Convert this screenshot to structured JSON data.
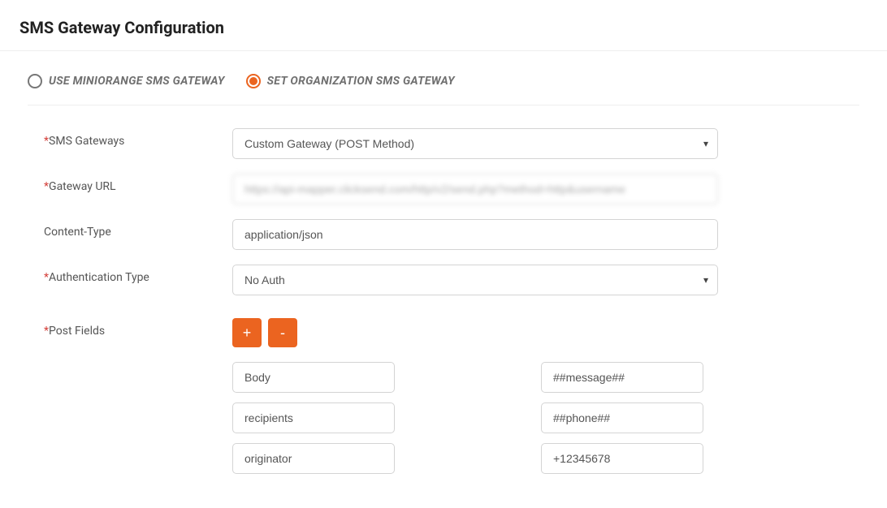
{
  "page": {
    "title": "SMS Gateway Configuration"
  },
  "gateway_mode": {
    "options": [
      {
        "label": "USE MINIORANGE SMS GATEWAY",
        "selected": false
      },
      {
        "label": "SET ORGANIZATION SMS GATEWAY",
        "selected": true
      }
    ]
  },
  "fields": {
    "sms_gateways": {
      "label": "SMS Gateways",
      "required": true,
      "value": "Custom Gateway (POST Method)"
    },
    "gateway_url": {
      "label": "Gateway URL",
      "required": true,
      "value": "https://api-mapper.clicksend.com/http/v2/send.php?method=http&username"
    },
    "content_type": {
      "label": "Content-Type",
      "required": false,
      "value": "application/json"
    },
    "auth_type": {
      "label": "Authentication Type",
      "required": true,
      "value": "No Auth"
    },
    "post_fields": {
      "label": "Post Fields",
      "required": true,
      "add_label": "+",
      "remove_label": "-",
      "pairs": [
        {
          "key": "Body",
          "value": "##message##"
        },
        {
          "key": "recipients",
          "value": "##phone##"
        },
        {
          "key": "originator",
          "value": "+12345678"
        }
      ]
    }
  }
}
